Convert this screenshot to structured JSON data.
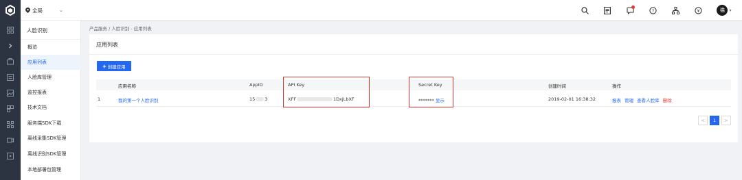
{
  "topbar": {
    "region": "全局",
    "avatar_text": "猫"
  },
  "sidebar": {
    "title": "人脸识别",
    "items": [
      {
        "label": "概览",
        "active": false
      },
      {
        "label": "应用列表",
        "active": true
      },
      {
        "label": "人脸库管理",
        "active": false
      },
      {
        "label": "监控报表",
        "active": false
      },
      {
        "label": "技术文档",
        "active": false
      },
      {
        "label": "服务端SDK下载",
        "active": false
      },
      {
        "label": "离线采集SDK管理",
        "active": false
      },
      {
        "label": "离线识别SDK管理",
        "active": false
      },
      {
        "label": "本地部署包管理",
        "active": false
      }
    ]
  },
  "breadcrumb": "产品服务 / 人脸识别 - 应用列表",
  "panel": {
    "title": "应用列表",
    "create_button": "创建应用"
  },
  "table": {
    "headers": {
      "name": "应用名称",
      "appid": "AppID",
      "apikey": "API Key",
      "secret": "Secret Key",
      "created": "创建时间",
      "actions": "操作"
    },
    "rows": [
      {
        "index": "1",
        "name": "我的第一个人脸识别",
        "appid_prefix": "15",
        "appid_suffix": "3",
        "apikey_prefix": "XFF",
        "apikey_suffix": "1DxjLbXF",
        "secret_masked": "*******",
        "secret_show": "显示",
        "created": "2019-02-01 16:38:32",
        "actions": {
          "report": "报表",
          "manage": "管理",
          "view_lib": "查看人脸库",
          "delete": "删除"
        }
      }
    ]
  },
  "pagination": {
    "prev": "<",
    "current": "1",
    "next": ">"
  },
  "colors": {
    "accent": "#2468f2",
    "highlight_border": "#d9352a",
    "danger": "#e53935",
    "rail": "#2b3440"
  }
}
